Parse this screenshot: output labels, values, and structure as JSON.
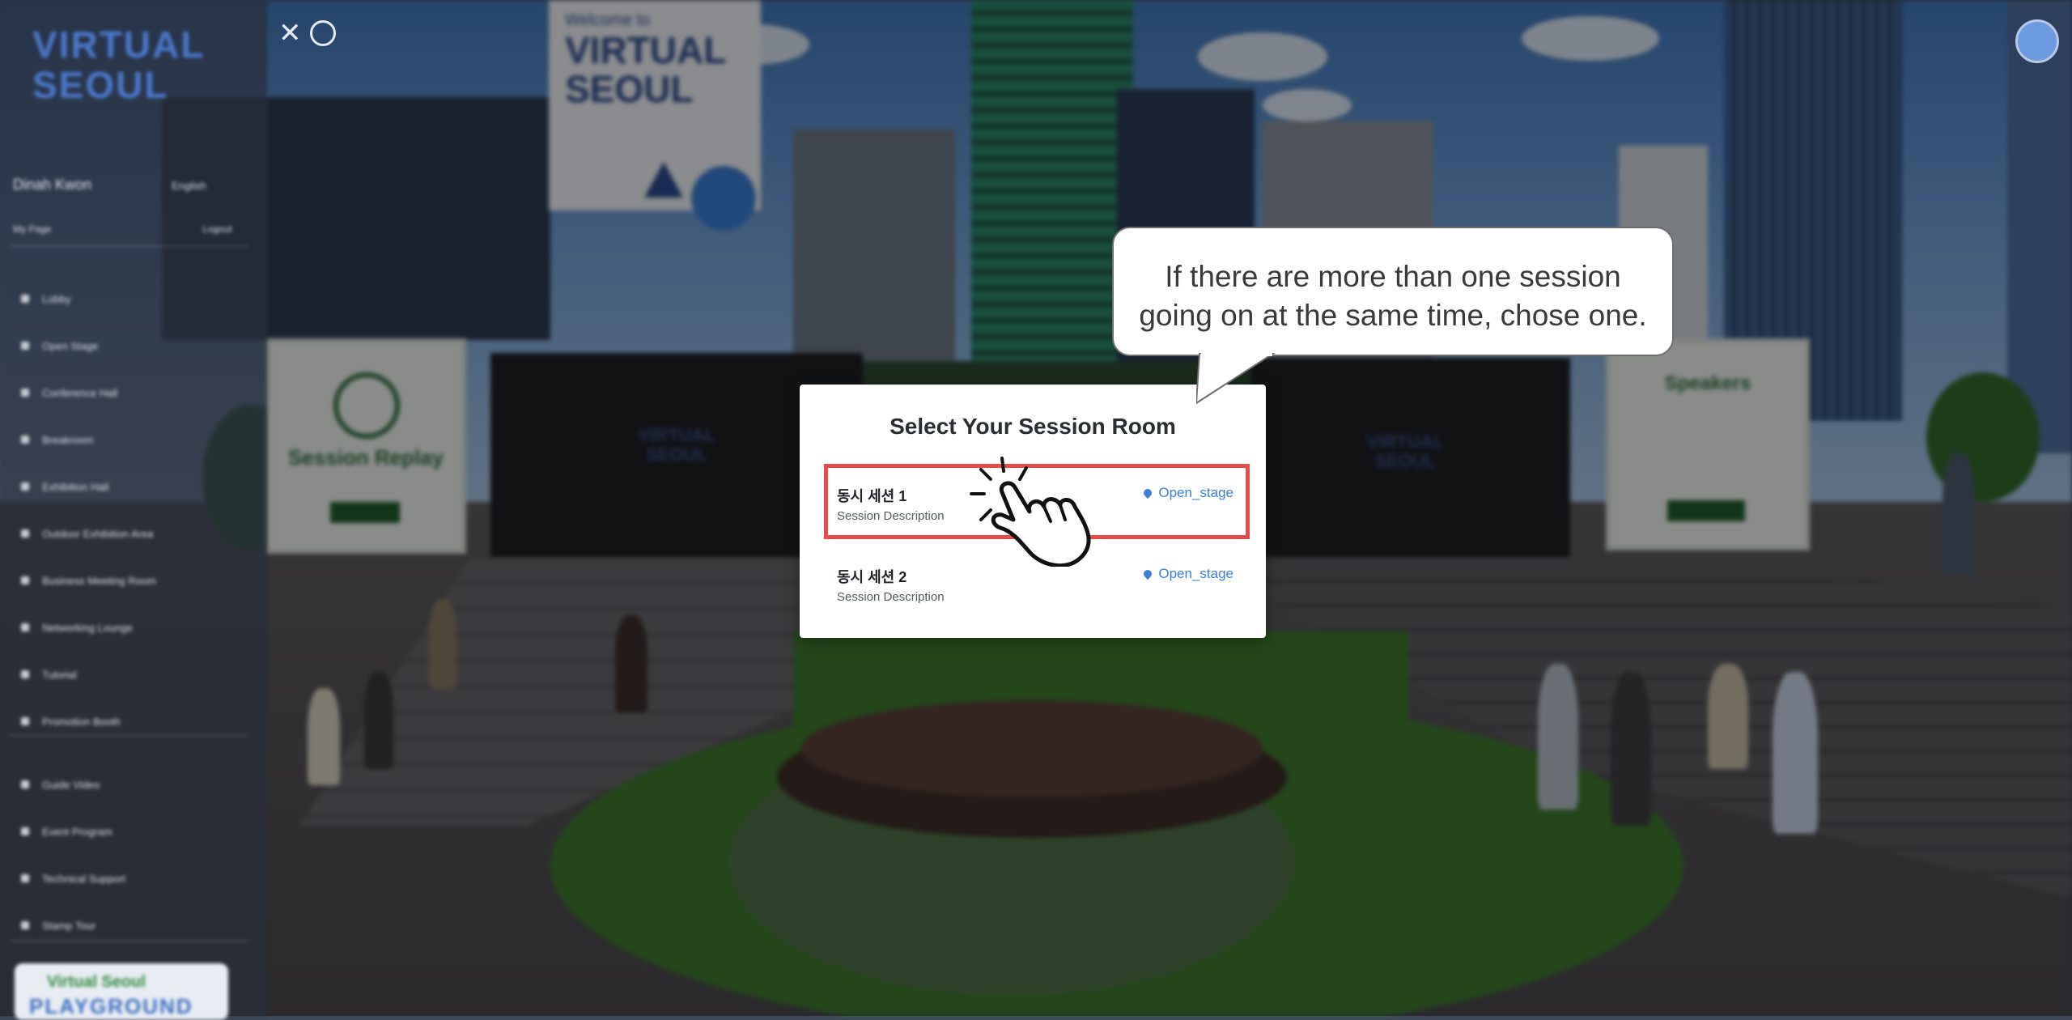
{
  "scene": {
    "banner_welcome": "Welcome to",
    "banner_brand": "VIRTUAL SEOUL",
    "board_left_title": "Session Replay",
    "board_right_title": "Speakers"
  },
  "sidebar": {
    "brand": "VIRTUAL SEOUL",
    "user_name": "Dinah Kwon",
    "language": "English",
    "my_page": "My Page",
    "logout": "Logout",
    "menu": [
      {
        "label": "Lobby",
        "icon": "home-icon"
      },
      {
        "label": "Open Stage",
        "icon": "stage-icon"
      },
      {
        "label": "Conference Hall",
        "icon": "hall-icon"
      },
      {
        "label": "Breakroom",
        "icon": "coffee-icon"
      },
      {
        "label": "Exhibition Hall",
        "icon": "exhibit-icon"
      },
      {
        "label": "Outdoor Exhibition Area",
        "icon": "outdoor-icon"
      },
      {
        "label": "Business Meeting Room",
        "icon": "meeting-icon"
      },
      {
        "label": "Networking Lounge",
        "icon": "lounge-icon"
      },
      {
        "label": "Tutorial",
        "icon": "tutorial-icon"
      },
      {
        "label": "Promotion Booth",
        "icon": "booth-icon"
      },
      {
        "label": "Guide Video",
        "icon": "video-icon"
      },
      {
        "label": "Event Program",
        "icon": "program-icon"
      },
      {
        "label": "Technical Support",
        "icon": "wrench-icon"
      },
      {
        "label": "Stamp Tour",
        "icon": "stamp-icon"
      }
    ],
    "badge_line1": "Virtual Seoul",
    "badge_line2": "PLAYGROUND"
  },
  "modal": {
    "title": "Select Your Session Room",
    "sessions": [
      {
        "name": "동시 세션 1",
        "description": "Session Description",
        "location": "Open_stage"
      },
      {
        "name": "동시 세션 2",
        "description": "Session Description",
        "location": "Open_stage"
      }
    ]
  },
  "callout": {
    "line1": "If there are more than one session",
    "line2": "going on at the same time, chose one."
  },
  "colors": {
    "highlight": "#e94b4b",
    "link": "#3c7fd4"
  }
}
